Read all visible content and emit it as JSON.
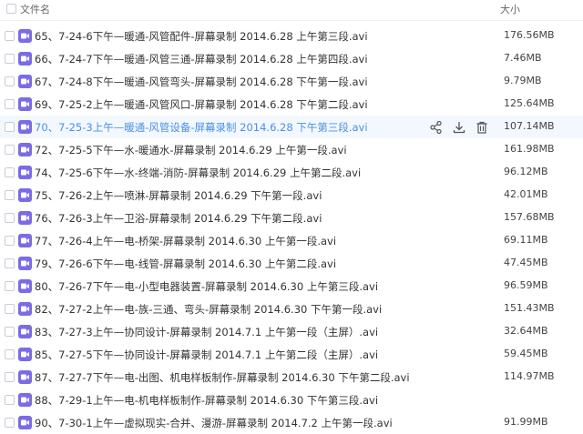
{
  "header": {
    "name_label": "文件名",
    "size_label": "大小"
  },
  "files": [
    {
      "name": "65、7-24-6下午—暖通-风管配件-屏幕录制 2014.6.28 上午第三段.avi",
      "size": "176.56MB"
    },
    {
      "name": "66、7-24-7下午—暖通-风管三通-屏幕录制 2014.6.28 上午第四段.avi",
      "size": "7.46MB"
    },
    {
      "name": "67、7-24-8下午—暖通-风管弯头-屏幕录制 2014.6.28 下午第一段.avi",
      "size": "9.79MB"
    },
    {
      "name": "69、7-25-2上午—暖通-风管风口-屏幕录制 2014.6.28 下午第二段.avi",
      "size": "125.64MB"
    },
    {
      "name": "70、7-25-3上午—暖通-风管设备-屏幕录制 2014.6.28 下午第三段.avi",
      "size": "107.14MB"
    },
    {
      "name": "72、7-25-5下午—水-暖通水-屏幕录制 2014.6.29 上午第一段.avi",
      "size": "161.98MB"
    },
    {
      "name": "74、7-25-6下午—水-终端-消防-屏幕录制 2014.6.29 上午第二段.avi",
      "size": "96.12MB"
    },
    {
      "name": "75、7-26-2上午—喷淋-屏幕录制 2014.6.29 下午第一段.avi",
      "size": "42.01MB"
    },
    {
      "name": "76、7-26-3上午—卫浴-屏幕录制 2014.6.29 下午第二段.avi",
      "size": "157.68MB"
    },
    {
      "name": "77、7-26-4上午—电-桥架-屏幕录制 2014.6.30 上午第一段.avi",
      "size": "69.11MB"
    },
    {
      "name": "79、7-26-6下午—电-线管-屏幕录制 2014.6.30 上午第二段.avi",
      "size": "47.45MB"
    },
    {
      "name": "80、7-26-7下午—电-小型电器装置-屏幕录制 2014.6.30 上午第三段.avi",
      "size": "96.59MB"
    },
    {
      "name": "82、7-27-2上午—电-族-三通、弯头-屏幕录制 2014.6.30 下午第一段.avi",
      "size": "151.43MB"
    },
    {
      "name": "83、7-27-3上午—协同设计-屏幕录制 2014.7.1 上午第一段（主屏）.avi",
      "size": "32.64MB"
    },
    {
      "name": "85、7-27-5下午—协同设计-屏幕录制 2014.7.1 上午第二段（主屏）.avi",
      "size": "59.45MB"
    },
    {
      "name": "87、7-27-7下午—电-出图、机电样板制作-屏幕录制 2014.6.30 下午第二段.avi",
      "size": "114.97MB"
    },
    {
      "name": "88、7-29-1上午—电-机电样板制作-屏幕录制 2014.6.30 下午第三段.avi",
      "size": ""
    },
    {
      "name": "90、7-30-1上午—虚拟现实-合并、漫游-屏幕录制 2014.7.2 上午第一段.avi",
      "size": "91.99MB"
    }
  ],
  "hover_index": 4,
  "icons": {
    "file": "video-file-icon",
    "share": "share-icon",
    "download": "download-icon",
    "delete": "trash-icon"
  },
  "colors": {
    "accent": "#4a90e2",
    "file_icon": "#7b6be4",
    "hover_bg": "#f3f8ff"
  }
}
